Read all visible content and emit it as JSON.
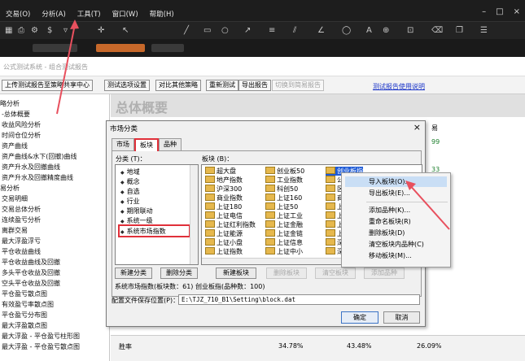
{
  "menubar": {
    "menus": [
      "交易(O)",
      "分析(A)",
      "工具(T)",
      "窗口(W)",
      "帮助(H)"
    ],
    "window_controls": [
      "–",
      "□",
      "×"
    ]
  },
  "toolbar": {
    "icons": [
      "grid-icon",
      "print-icon",
      "settings-icon",
      "dollar-icon",
      "cross-icon",
      "filter-icon",
      "cursor-icon",
      "draw-line-icon",
      "text-icon",
      "zoom-icon"
    ]
  },
  "window": {
    "title": "公式测试系统 - 组合测试报告"
  },
  "actions": {
    "buttons": [
      "上传测试报告至策略共享中心",
      "测试选项设置",
      "对比其他策略",
      "重新测试",
      "导出报告"
    ],
    "disabled_button": "切换到简易报告",
    "link": "测试报告使用说明"
  },
  "leftnav": {
    "items": [
      {
        "text": "略分析",
        "section": true
      },
      {
        "text": "-总体概要",
        "section": false
      },
      {
        "text": "收益风险分析",
        "section": false
      },
      {
        "text": "时间仓位分析",
        "section": false
      },
      {
        "text": "资产曲线",
        "section": false
      },
      {
        "text": "资产曲线&水下(回撤)曲线",
        "section": false
      },
      {
        "text": "资产升水及回撤曲线",
        "section": false
      },
      {
        "text": "资产升水及回撤精度曲线",
        "section": false
      },
      {
        "text": "易分析",
        "section": true
      },
      {
        "text": "交易明细",
        "section": false
      },
      {
        "text": "交易总体分析",
        "section": false
      },
      {
        "text": "连续盈亏分析",
        "section": false
      },
      {
        "text": "离群交易",
        "section": false
      },
      {
        "text": "最大浮盈浮亏",
        "section": false
      },
      {
        "text": "平仓收益曲线",
        "section": false
      },
      {
        "text": "平仓收益曲线及回撤",
        "section": false
      },
      {
        "text": "多头平仓收益及回撤",
        "section": false
      },
      {
        "text": "空头平仓收益及回撤",
        "section": false
      },
      {
        "text": "平仓盈亏散点图",
        "section": false
      },
      {
        "text": "有效盈亏率散点图",
        "section": false
      },
      {
        "text": "平仓盈亏分布图",
        "section": false
      },
      {
        "text": "最大浮盈散点图",
        "section": false
      },
      {
        "text": "最大浮盈 - 平仓盈亏柱形图",
        "section": false
      },
      {
        "text": "最大浮盈 - 平仓盈亏散点图",
        "section": false
      }
    ]
  },
  "report": {
    "overview_title": "总体概要",
    "right_header": "易",
    "right_values": [
      "99",
      "33"
    ],
    "stats": {
      "label": "胜率",
      "v1": "34.78%",
      "v2": "43.48%",
      "v3": "26.09%"
    }
  },
  "dialog": {
    "title": "市场分类",
    "close": "×",
    "tabs": [
      "市场",
      "板块",
      "品种"
    ],
    "active_tab": "板块",
    "category_label": "分类 (T)：",
    "block_label": "板块 (B)：",
    "categories": [
      "地域",
      "概念",
      "自选",
      "行业",
      "期限联动",
      "系统一级",
      "系统市场指数"
    ],
    "selected_category": "系统市场指数",
    "blocks": [
      [
        "超大盘",
        "创业板50",
        "创业板指"
      ],
      [
        "地产指数",
        "工业指数",
        "公用"
      ],
      [
        "沪深300",
        "科创50",
        "区块"
      ],
      [
        "商业指数",
        "上证160",
        "商品"
      ],
      [
        "上证180",
        "上证50",
        "上证"
      ],
      [
        "上证电信",
        "上证工业",
        "上证"
      ],
      [
        "上证红利指数",
        "上证金融",
        "上证"
      ],
      [
        "上证能源",
        "上证金链",
        "上证"
      ],
      [
        "上证小盘",
        "上证信息",
        "深圳"
      ],
      [
        "上证指数",
        "上证中小",
        "深证"
      ]
    ],
    "selected_block": "创业板指",
    "buttons": [
      "新建分类",
      "删除分类",
      "新建板块",
      "删除板块",
      "清空板块",
      "添加品种"
    ],
    "disabled_buttons": [
      "删除板块",
      "清空板块",
      "添加品种"
    ],
    "summary": "系统市场指数(板块数：61)  创业板指(品种数：100)",
    "path_label": "配置文件保存位置(P)：",
    "path_value": "E:\\TJZ_710_B1\\Setting\\block.dat",
    "ok": "确定",
    "cancel": "取消"
  },
  "context_menu": {
    "items": [
      "导入板块(O)...",
      "导出板块(E)...",
      "添加品种(K)...",
      "重命名板块(R)",
      "删除板块(D)",
      "清空板块内品种(C)",
      "移动板块(M)..."
    ],
    "highlighted": "导入板块(O)..."
  },
  "colors": {
    "highlight_red": "#e0303a",
    "selection_blue": "#1f5bd6",
    "link_blue": "#1a34c8",
    "menu_hover": "#c9def5",
    "dark_chrome": "#1d1d1d"
  }
}
